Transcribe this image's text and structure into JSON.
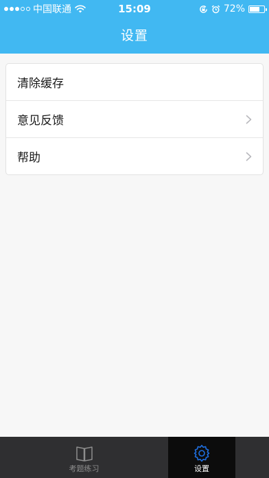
{
  "status_bar": {
    "signal_dots": [
      "on",
      "on",
      "on",
      "off",
      "off"
    ],
    "carrier": "中国联通",
    "time": "15:09",
    "battery_percent": "72%",
    "battery_level": 0.72,
    "icons": [
      "wifi-icon",
      "rotation-lock-icon",
      "alarm-icon",
      "battery-icon"
    ]
  },
  "nav": {
    "title": "设置"
  },
  "settings": {
    "items": [
      {
        "label": "清除缓存",
        "has_chevron": false
      },
      {
        "label": "意见反馈",
        "has_chevron": true
      },
      {
        "label": "帮助",
        "has_chevron": true
      }
    ]
  },
  "tab_bar": {
    "tabs": [
      {
        "label": "考题练习",
        "icon": "book-icon",
        "active": false
      },
      {
        "label": "设置",
        "icon": "gear-icon",
        "active": true
      }
    ]
  },
  "colors": {
    "header_bg": "#41b8f2",
    "page_bg": "#f7f7f7",
    "tab_bar_bg": "#2f2f31",
    "tab_active_bg": "#0c0c0c",
    "tab_active_icon": "#1f6fe0",
    "tab_inactive": "#8e8e8e"
  }
}
